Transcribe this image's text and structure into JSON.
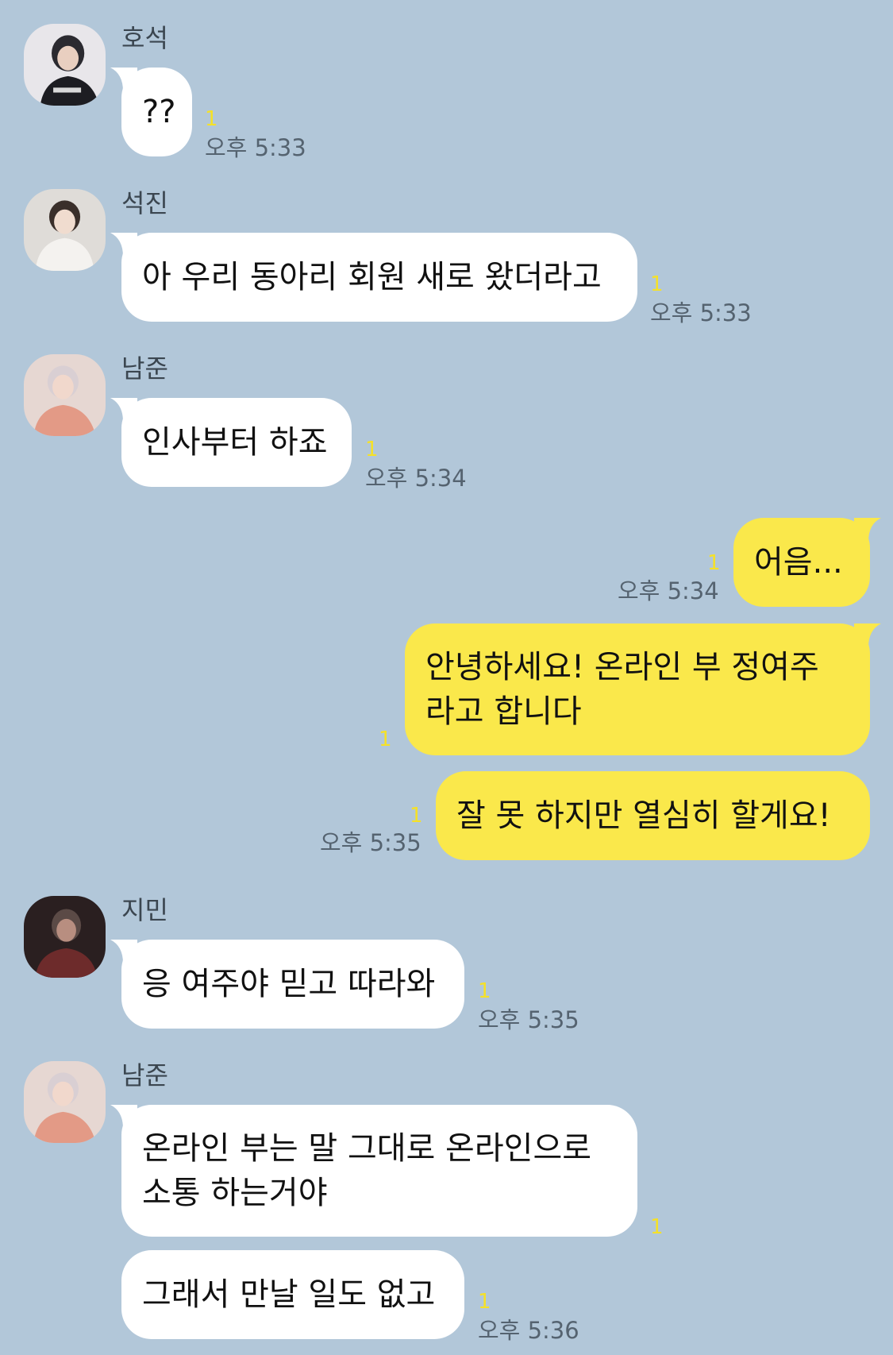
{
  "messages": [
    {
      "sender": "호석",
      "text": "??",
      "unread": "1",
      "time": "오후 5:33"
    },
    {
      "sender": "석진",
      "text": "아 우리 동아리 회원 새로 왔더라고",
      "unread": "1",
      "time": "오후 5:33"
    },
    {
      "sender": "남준",
      "text": "인사부터 하죠",
      "unread": "1",
      "time": "오후 5:34"
    },
    {
      "sender": "me",
      "text": "어음...",
      "unread": "1",
      "time": "오후 5:34"
    },
    {
      "sender": "me",
      "line1": "안녕하세요! 온라인 부 정여주",
      "line2": "라고 합니다",
      "unread": "1"
    },
    {
      "sender": "me",
      "text": "잘 못 하지만 열심히 할게요!",
      "unread": "1",
      "time": "오후 5:35"
    },
    {
      "sender": "지민",
      "text": "응 여주야 믿고 따라와",
      "unread": "1",
      "time": "오후 5:35"
    },
    {
      "sender": "남준",
      "line1": "온라인 부는 말 그대로 온라인으로",
      "line2": "소통 하는거야",
      "unread": "1"
    },
    {
      "sender": "남준",
      "text": "그래서 만날 일도 없고",
      "unread": "1",
      "time": "오후 5:36"
    }
  ],
  "colors": {
    "background": "#b2c7d9",
    "my_bubble": "#fae84b",
    "their_bubble": "#ffffff",
    "unread": "#f5e128"
  },
  "avatars": [
    "profile-hoseok",
    "profile-seokjin",
    "profile-namjoon",
    "profile-jimin",
    "profile-namjoon"
  ]
}
